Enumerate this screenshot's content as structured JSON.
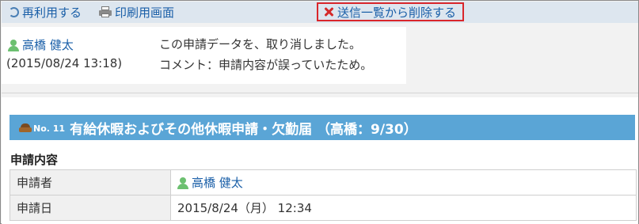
{
  "toolbar": {
    "reuse_label": "再利用する",
    "print_label": "印刷用画面",
    "delete_label": "送信一覧から削除する"
  },
  "notice": {
    "user": "高橋 健太",
    "datetime": "(2015/08/24 13:18)",
    "message": "この申請データを、取り消しました。",
    "comment": "コメント：申請内容が誤っていたため。"
  },
  "request": {
    "no_label": "No. 11",
    "title": "有給休暇およびその他休暇申請・欠勤届 （高橋：9/30）",
    "section_heading": "申請内容",
    "rows": [
      {
        "label": "申請者",
        "value": "高橋 健太"
      },
      {
        "label": "申請日",
        "value": "2015/8/24（月） 12:34"
      }
    ]
  },
  "colors": {
    "toolbar_bg": "#dde6ef",
    "link": "#1a5fa8",
    "title_bar": "#5aa5d6",
    "highlight_border": "#d9262b"
  }
}
